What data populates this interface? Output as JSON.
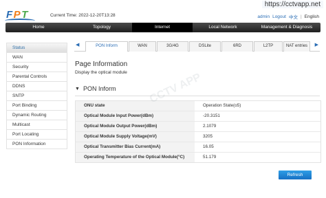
{
  "brand": {
    "logo_letters": [
      "F",
      "P",
      "T"
    ],
    "colors": {
      "f": "#2a6db5",
      "p": "#f07d1a",
      "t": "#4aa84a"
    }
  },
  "header": {
    "current_time_label": "Current Time:",
    "current_time_value": "2022-12-20T13:28",
    "watermark_url": "https://cctvapp.net",
    "links": {
      "admin": "admin",
      "logout": "Logout",
      "chinese": "中文",
      "separator": "|",
      "english": "English"
    }
  },
  "main_nav": {
    "tabs": [
      {
        "label": "Home"
      },
      {
        "label": "Topology"
      },
      {
        "label": "Internet"
      },
      {
        "label": "Local Network"
      },
      {
        "label": "Management & Diagnosis"
      }
    ],
    "active_index": 2
  },
  "sidebar": {
    "items": [
      {
        "label": "Status"
      },
      {
        "label": "WAN"
      },
      {
        "label": "Security"
      },
      {
        "label": "Parental Controls"
      },
      {
        "label": "DDNS"
      },
      {
        "label": "SNTP"
      },
      {
        "label": "Port Binding"
      },
      {
        "label": "Dynamic Routing"
      },
      {
        "label": "Multicast"
      },
      {
        "label": "Port Locating"
      },
      {
        "label": "PON Information"
      }
    ]
  },
  "sub_tabs": {
    "prev_arrow": "◀",
    "next_arrow": "▶",
    "tabs": [
      {
        "label": "PON Inform"
      },
      {
        "label": "WAN"
      },
      {
        "label": "3G/4G"
      },
      {
        "label": "DSLite"
      },
      {
        "label": "6RD"
      },
      {
        "label": "L2TP"
      },
      {
        "label": "NAT entries"
      }
    ]
  },
  "page": {
    "title": "Page Information",
    "description": "Display the optical module",
    "section_title": "PON Inform",
    "section_toggle_icon": "▼"
  },
  "table": {
    "rows": [
      {
        "label": "ONU state",
        "value": "Operation State(o5)"
      },
      {
        "label": "Optical Module Input Power(dBm)",
        "value": "-20.3151"
      },
      {
        "label": "Optical Module Output Power(dBm)",
        "value": "2.1079"
      },
      {
        "label": "Optical Module Supply Voltage(mV)",
        "value": "3205"
      },
      {
        "label": "Optical Transmitter Bias Current(mA)",
        "value": "16.05"
      },
      {
        "label": "Operating Temperature of the Optical Module(°C)",
        "value": "51.179"
      }
    ]
  },
  "watermark_text": "CCTV APP",
  "buttons": {
    "refresh": "Refresh"
  }
}
